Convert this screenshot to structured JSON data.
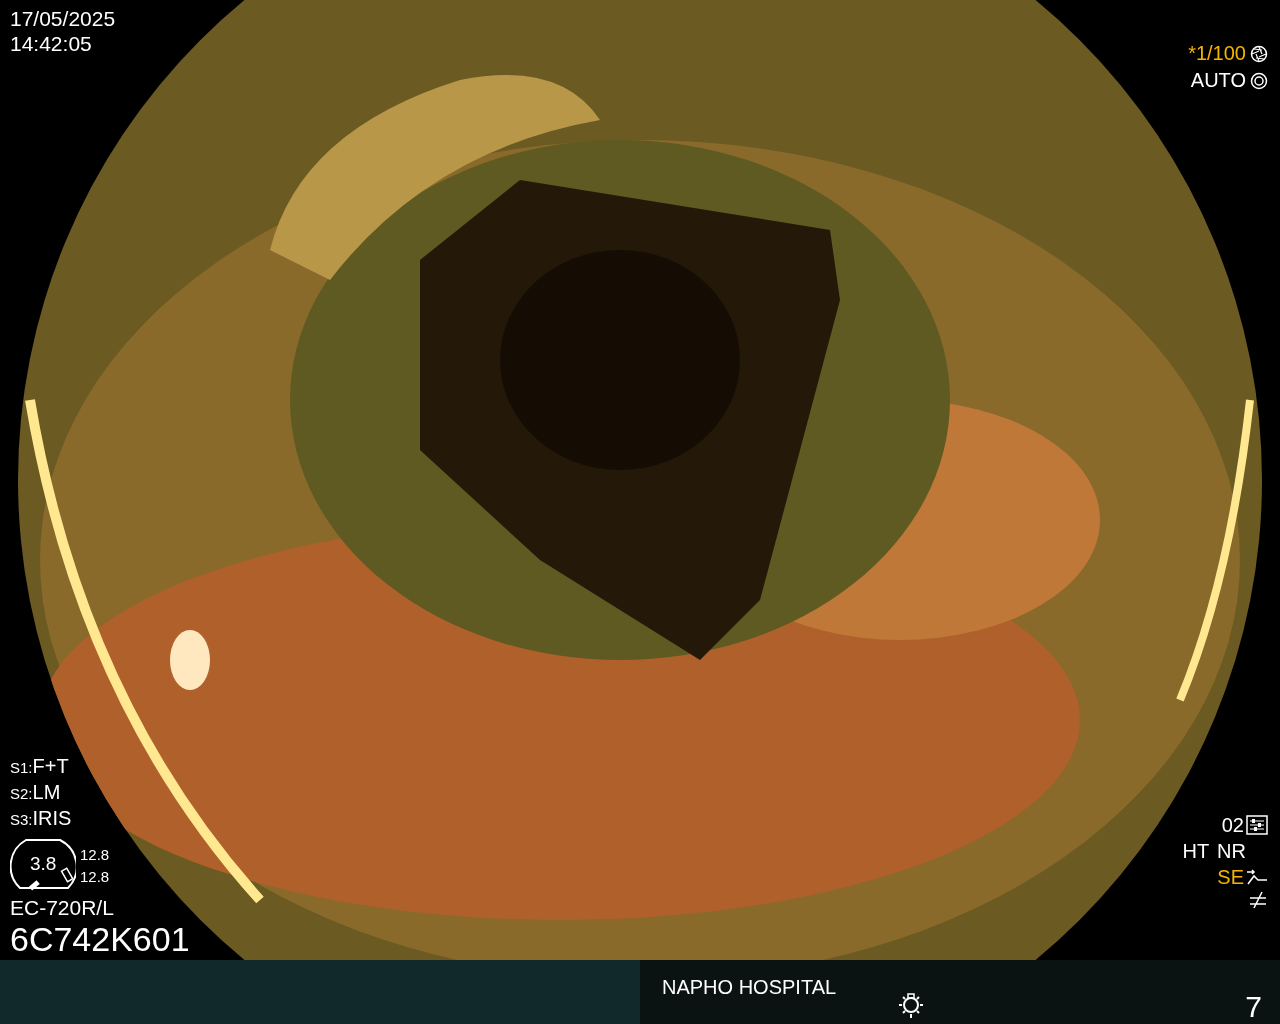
{
  "datetime": {
    "date": "17/05/2025",
    "time": "14:42:05"
  },
  "shutter": {
    "value": "*1/100",
    "highlighted": true
  },
  "exposure": {
    "value": "AUTO",
    "highlighted": false
  },
  "scope_settings": [
    {
      "key": "S1:",
      "value": "F+T"
    },
    {
      "key": "S2:",
      "value": "LM"
    },
    {
      "key": "S3:",
      "value": "IRIS"
    }
  ],
  "gauge": {
    "value": "3.8",
    "readings": [
      "12.8",
      "12.8"
    ]
  },
  "scope_model": "EC-720R/L",
  "serial": "6C742K601",
  "enhancement": {
    "level": "02",
    "items": [
      {
        "label": "HT",
        "highlighted": false
      },
      {
        "label": "NR",
        "highlighted": false
      }
    ],
    "structure": {
      "label": "SE",
      "highlighted": true
    }
  },
  "footer": {
    "hospital": "NAPHO HOSPITAL",
    "page": "7"
  }
}
